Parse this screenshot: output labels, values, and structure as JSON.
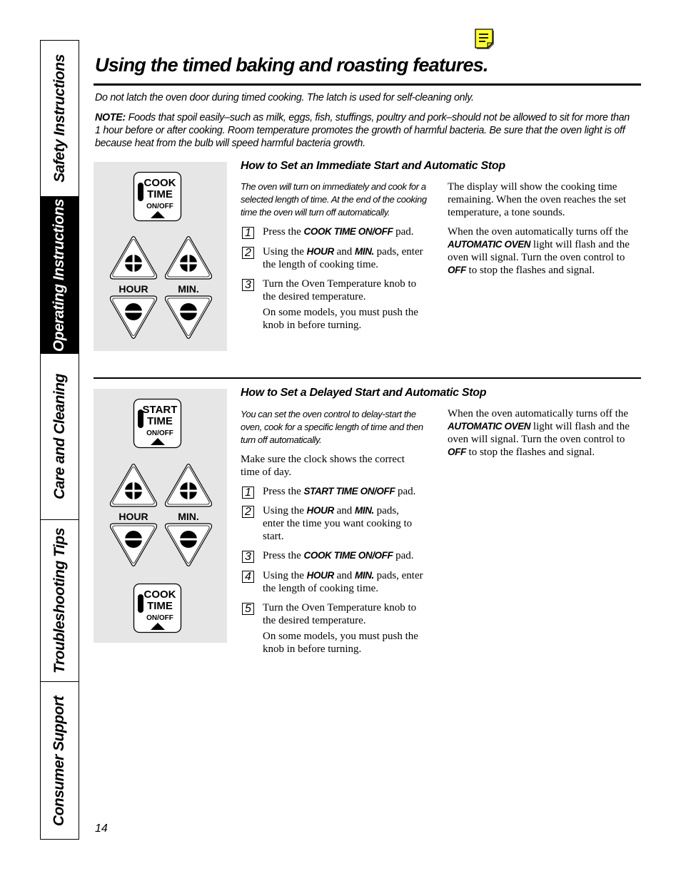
{
  "sidebar": {
    "tabs": [
      {
        "label": "Safety Instructions",
        "active": false
      },
      {
        "label": "Operating Instructions",
        "active": true
      },
      {
        "label": "Care and Cleaning",
        "active": false
      },
      {
        "label": "Troubleshooting Tips",
        "active": false
      },
      {
        "label": "Consumer Support",
        "active": false
      }
    ]
  },
  "header": {
    "note_icon": "note-icon",
    "title": "Using the timed baking and roasting features."
  },
  "intro": {
    "warning": "Do not latch the oven door during timed cooking. The latch is used for self-cleaning only.",
    "note_label": "NOTE:",
    "note_text": " Foods that spoil easily–such as milk, eggs, fish, stuffings, poultry and pork–should not be allowed to sit for more than 1 hour before or after cooking. Room temperature promotes the growth of harmful bacteria. Be sure that the oven light is off because heat from the bulb will speed harmful bacteria growth."
  },
  "keypad": {
    "cook_time": [
      "COOK",
      "TIME",
      "ON/OFF"
    ],
    "start_time": [
      "START",
      "TIME",
      "ON/OFF"
    ],
    "hour_label": "HOUR",
    "min_label": "MIN."
  },
  "section1": {
    "heading": "How to Set an Immediate Start and Automatic Stop",
    "lead": "The oven will turn on immediately and cook for a selected length of time. At the end of the cooking time the oven will turn off automatically.",
    "steps": [
      {
        "num": "1",
        "pre": "Press the ",
        "kw": "COOK TIME ON/OFF",
        "post": " pad."
      },
      {
        "num": "2",
        "pre": "Using the ",
        "kw": "HOUR",
        "mid": " and ",
        "kw2": "MIN.",
        "post": " pads, enter the length of cooking time."
      },
      {
        "num": "3",
        "pre": "Turn the Oven Temperature knob to the desired temperature."
      }
    ],
    "step3_note": "On some models, you must push the knob in before turning.",
    "right_p1": "The display will show the cooking time remaining. When the oven reaches the set temperature, a tone sounds.",
    "right_p2_pre": "When the oven automatically turns off the ",
    "right_p2_kw": "AUTOMATIC OVEN",
    "right_p2_mid": " light will flash and the oven will signal. Turn the oven control to ",
    "right_p2_kw2": "OFF",
    "right_p2_post": " to stop the flashes and signal."
  },
  "section2": {
    "heading": "How to Set a Delayed Start and Automatic Stop",
    "lead": "You can set the oven control to delay-start the oven, cook for a specific length of time and then turn off automatically.",
    "clock_note": "Make sure the clock shows the correct time of day.",
    "steps": [
      {
        "num": "1",
        "pre": "Press the ",
        "kw": "START TIME ON/OFF",
        "post": " pad."
      },
      {
        "num": "2",
        "pre": "Using the ",
        "kw": "HOUR",
        "mid": " and ",
        "kw2": "MIN.",
        "post": " pads, enter the time you want cooking to start."
      },
      {
        "num": "3",
        "pre": "Press the ",
        "kw": "COOK TIME ON/OFF",
        "post": " pad."
      },
      {
        "num": "4",
        "pre": "Using the ",
        "kw": "HOUR",
        "mid": " and ",
        "kw2": "MIN.",
        "post": " pads, enter the length of cooking time."
      },
      {
        "num": "5",
        "pre": "Turn the Oven Temperature knob to the desired temperature."
      }
    ],
    "step5_note": "On some models, you must push the knob in before turning.",
    "right_p1_pre": "When the oven automatically turns off the ",
    "right_p1_kw": "AUTOMATIC OVEN",
    "right_p1_mid": " light will flash and the oven will signal. Turn the oven control to ",
    "right_p1_kw2": "OFF",
    "right_p1_post": " to stop the flashes and signal."
  },
  "footer": {
    "page_number": "14"
  }
}
